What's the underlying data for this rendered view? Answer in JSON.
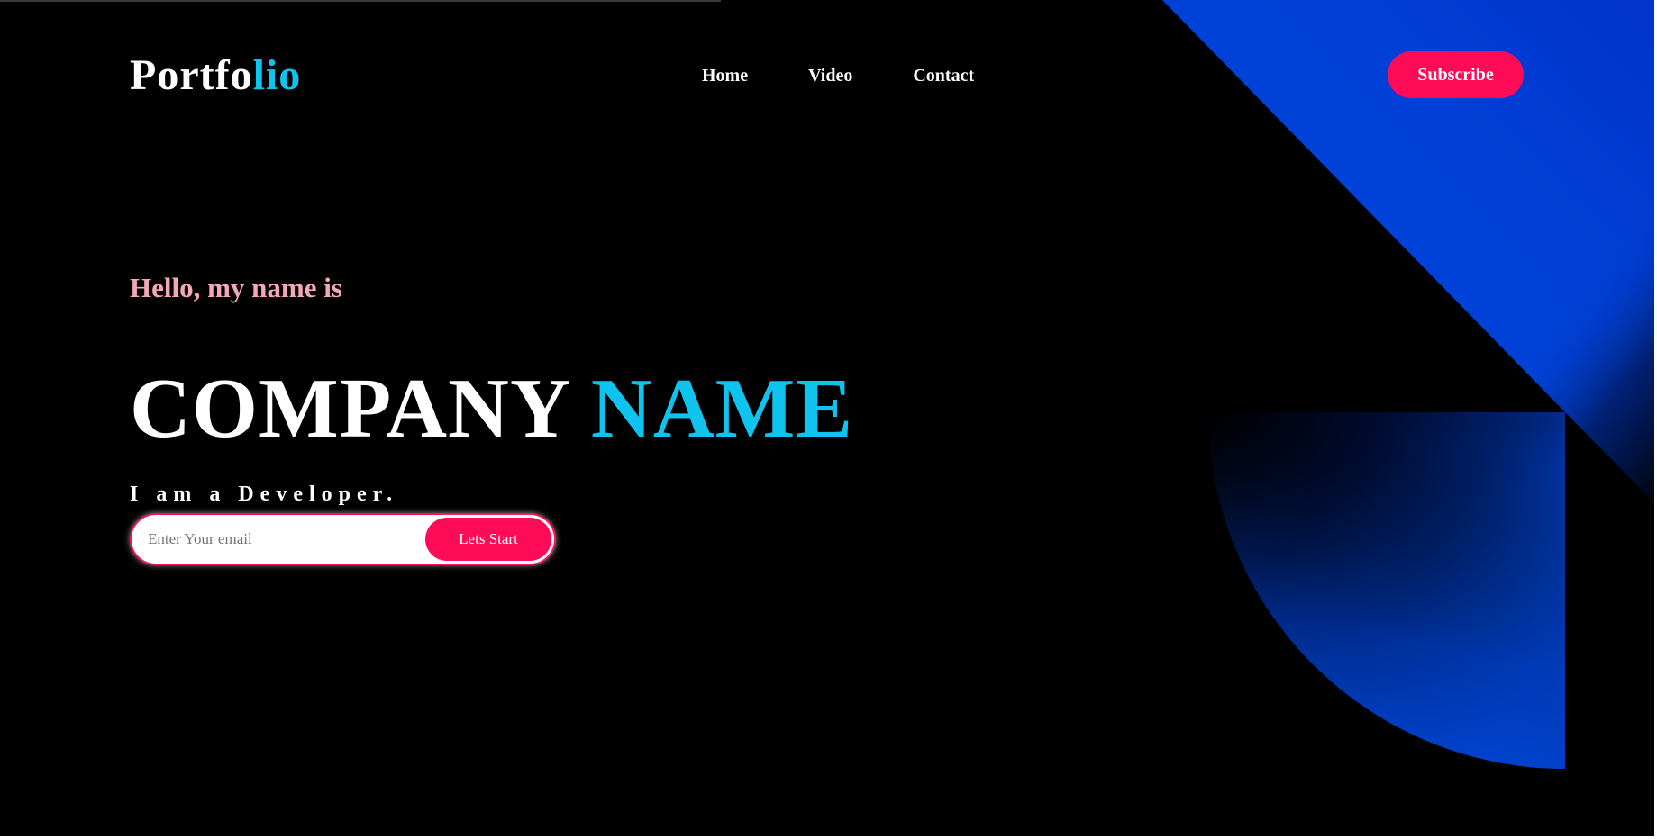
{
  "header": {
    "logo_main": "Portfo",
    "logo_accent": "lio",
    "nav": [
      {
        "label": "Home"
      },
      {
        "label": "Video"
      },
      {
        "label": "Contact"
      }
    ],
    "subscribe_label": "Subscribe"
  },
  "hero": {
    "greeting": "Hello, my name is",
    "title_main": "COMPANY",
    "title_accent": "NAME",
    "role": "I am a Developer.",
    "email_placeholder": "Enter Your email",
    "cta_label": "Lets Start"
  },
  "colors": {
    "background": "#000000",
    "accent_cyan": "#0ec4ee",
    "accent_pink": "#ff0b57",
    "greeting_pink": "#f4a7b6",
    "decor_blue": "#0049e0"
  }
}
